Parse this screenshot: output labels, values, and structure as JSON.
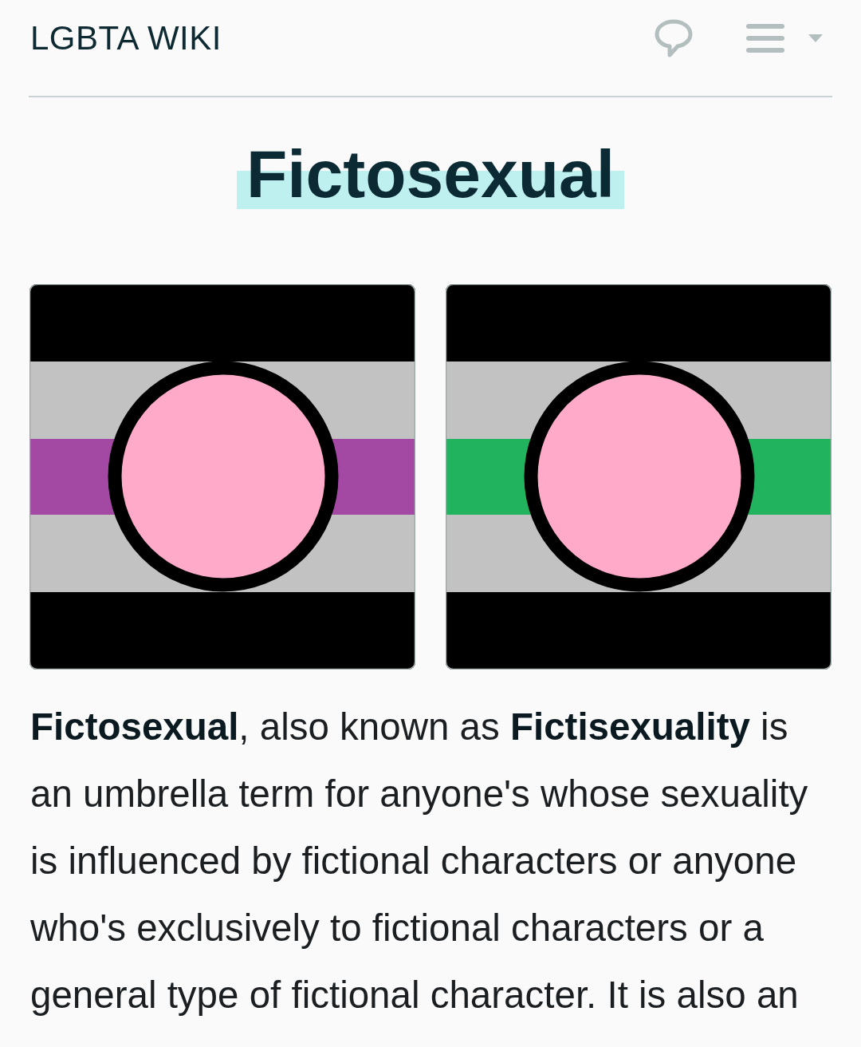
{
  "header": {
    "site_title": "LGBTA WIKI"
  },
  "page_title": "Fictosexual",
  "flags": [
    {
      "color": "#a349a4"
    },
    {
      "color": "#22b35e"
    }
  ],
  "article": {
    "paragraph": "**Fictosexual**, also known as **Fictisexuality** is an umbrella term for anyone's whose sexuality is influenced by fictional characters or anyone who's exclusively to fictional characters or a general type of fictional character. It is also an"
  }
}
